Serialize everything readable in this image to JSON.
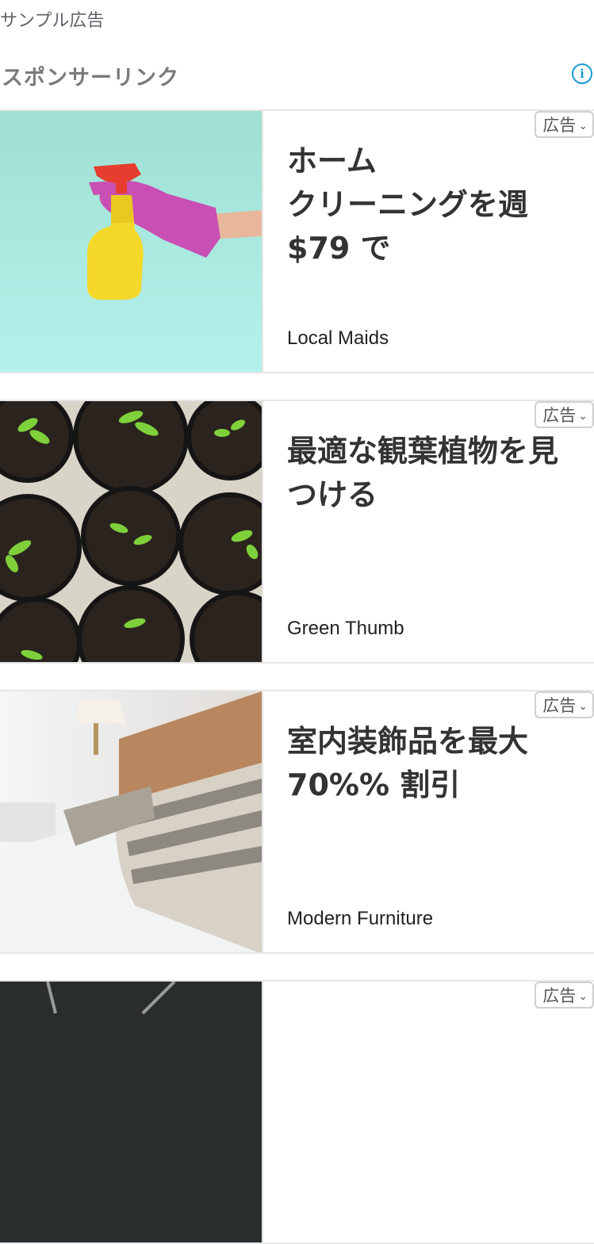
{
  "page": {
    "sample_label": "サンプル広告",
    "sponsor_title": "スポンサーリンク",
    "info_glyph": "i"
  },
  "ads": [
    {
      "badge": "広告",
      "headline": "ホーム\nクリーニングを週 $79 で",
      "advertiser": "Local Maids"
    },
    {
      "badge": "広告",
      "headline": "最適な観葉植物を見つける",
      "advertiser": "Green Thumb"
    },
    {
      "badge": "広告",
      "headline": "室内装飾品を最大 70%% 割引",
      "advertiser": "Modern Furniture"
    },
    {
      "badge": "広告"
    }
  ],
  "colors": {
    "info": "#1a9ad6",
    "border": "#e6e6e6"
  }
}
